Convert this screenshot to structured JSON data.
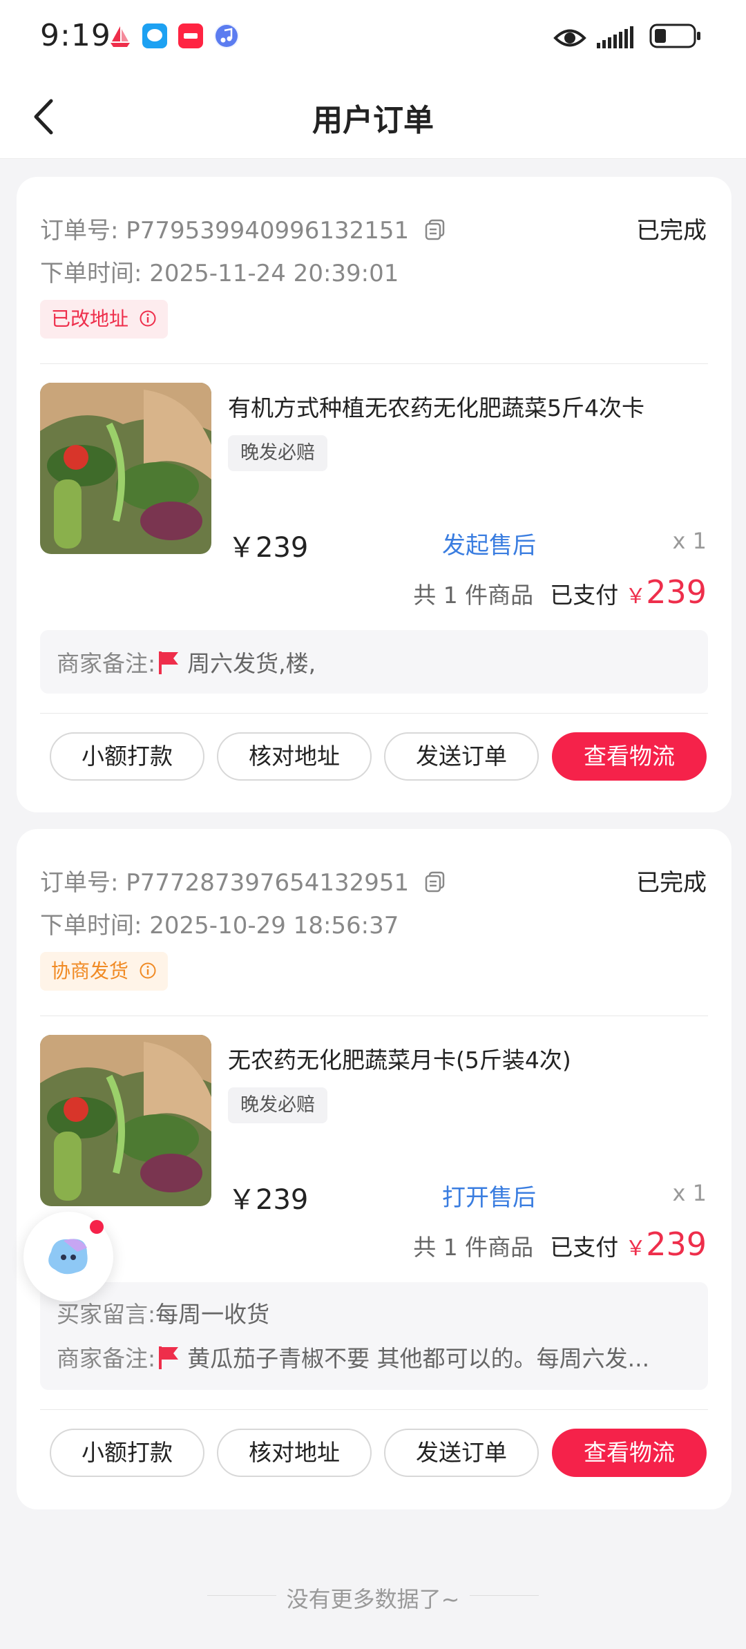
{
  "status_bar": {
    "time": "9:19"
  },
  "header": {
    "title": "用户订单"
  },
  "orders": [
    {
      "order_no_label": "订单号:",
      "order_no": "P779539940996132151",
      "status": "已完成",
      "time_label": "下单时间:",
      "time": "2025-11-24 20:39:01",
      "tag": "已改地址",
      "product_title": "有机方式种植无农药无化肥蔬菜5斤4次卡",
      "product_tag": "晚发必赔",
      "price": "￥239",
      "aftersale": "发起售后",
      "qty": "x 1",
      "count_text": "共 1 件商品",
      "paid_label": "已支付",
      "paid_currency": "￥",
      "paid_amount": "239",
      "notes": [
        {
          "label": "商家备注:",
          "text": "周六发货,楼,",
          "flag": true
        }
      ],
      "buttons": [
        "小额打款",
        "核对地址",
        "发送订单",
        "查看物流"
      ]
    },
    {
      "order_no_label": "订单号:",
      "order_no": "P777287397654132951",
      "status": "已完成",
      "time_label": "下单时间:",
      "time": "2025-10-29 18:56:37",
      "tag": "协商发货",
      "product_title": "无农药无化肥蔬菜月卡(5斤装4次)",
      "product_tag": "晚发必赔",
      "price": "￥239",
      "aftersale": "打开售后",
      "qty": "x 1",
      "count_text": "共 1 件商品",
      "paid_label": "已支付",
      "paid_currency": "￥",
      "paid_amount": "239",
      "notes": [
        {
          "label": "买家留言:",
          "text": "每周一收货",
          "flag": false
        },
        {
          "label": "商家备注:",
          "text": "黄瓜茄子青椒不要 其他都可以的。每周六发...",
          "flag": true
        }
      ],
      "buttons": [
        "小额打款",
        "核对地址",
        "发送订单",
        "查看物流"
      ]
    }
  ],
  "footer": {
    "no_more": "没有更多数据了~"
  },
  "colors": {
    "accent": "#f5224a",
    "link": "#3a7de0",
    "tag_red": "#ee2e4b",
    "tag_orange": "#f08a24"
  }
}
